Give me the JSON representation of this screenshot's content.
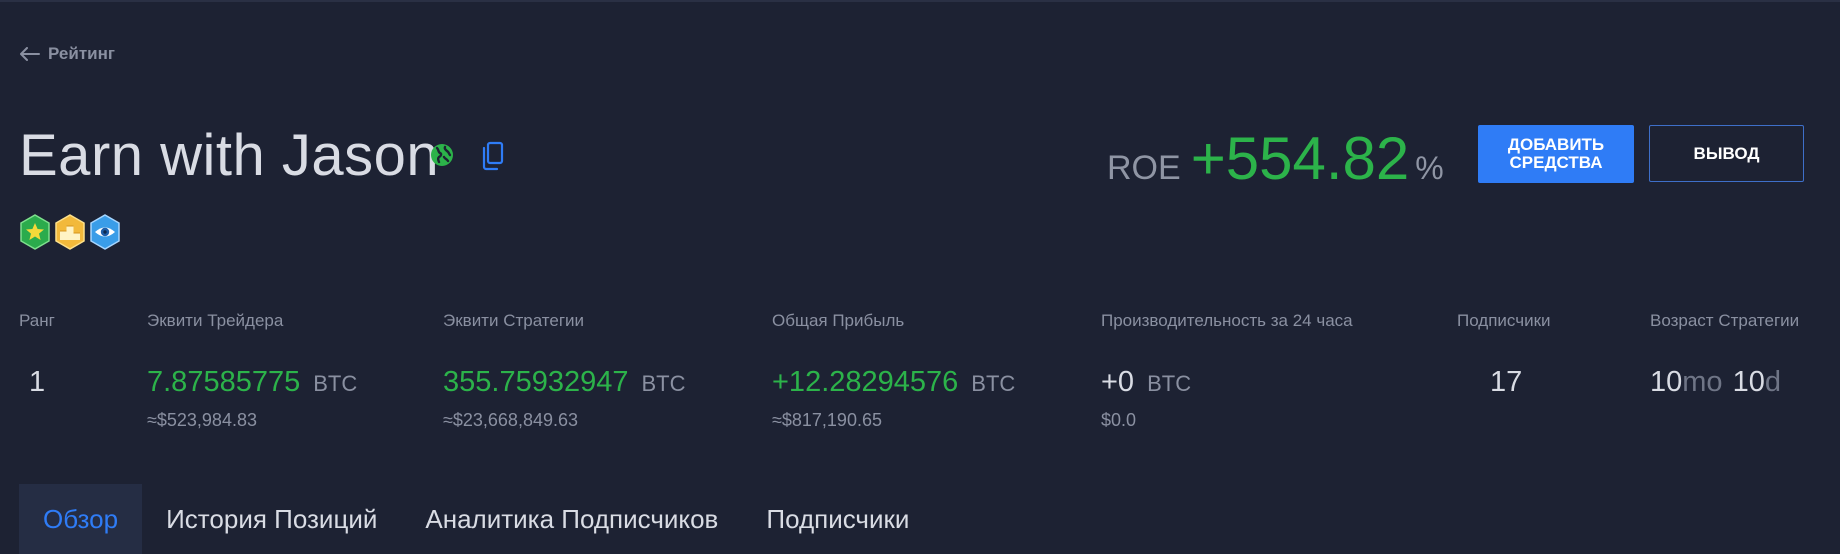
{
  "nav": {
    "back_label": "Рейтинг",
    "back_icon": "arrow-left-icon"
  },
  "header": {
    "title": "Earn with Jason",
    "icons": [
      "globe-icon",
      "copy-icon"
    ],
    "badges": [
      "star-badge-icon",
      "podium-badge-icon",
      "eye-badge-icon"
    ]
  },
  "roe": {
    "label": "ROE",
    "value": "+554.82",
    "unit": "%"
  },
  "actions": {
    "add_funds_line1": "ДОБАВИТЬ",
    "add_funds_line2": "СРЕДСТВА",
    "withdraw": "ВЫВОД"
  },
  "stats": {
    "rank": {
      "label": "Ранг",
      "value": "1"
    },
    "trader_equity": {
      "label": "Эквити Трейдера",
      "value": "7.87585775",
      "unit": "BTC",
      "usd": "≈$523,984.83"
    },
    "strategy_equity": {
      "label": "Эквити Стратегии",
      "value": "355.75932947",
      "unit": "BTC",
      "usd": "≈$23,668,849.63"
    },
    "total_profit": {
      "label": "Общая Прибыль",
      "value": "+12.28294576",
      "unit": "BTC",
      "usd": "≈$817,190.65"
    },
    "perf_24h": {
      "label": "Производительность за 24 часа",
      "value": "+0",
      "unit": "BTC",
      "usd": "$0.0"
    },
    "subscribers": {
      "label": "Подписчики",
      "value": "17"
    },
    "strategy_age": {
      "label": "Возраст Стратегии",
      "months": "10",
      "months_unit": "mo",
      "days": "10",
      "days_unit": "d"
    }
  },
  "tabs": [
    {
      "label": "Обзор",
      "active": true
    },
    {
      "label": "История Позиций",
      "active": false
    },
    {
      "label": "Аналитика Подписчиков",
      "active": false
    },
    {
      "label": "Подписчики",
      "active": false
    }
  ],
  "colors": {
    "background": "#1d2233",
    "positive": "#2cb34a",
    "accent": "#2f7cf6"
  }
}
